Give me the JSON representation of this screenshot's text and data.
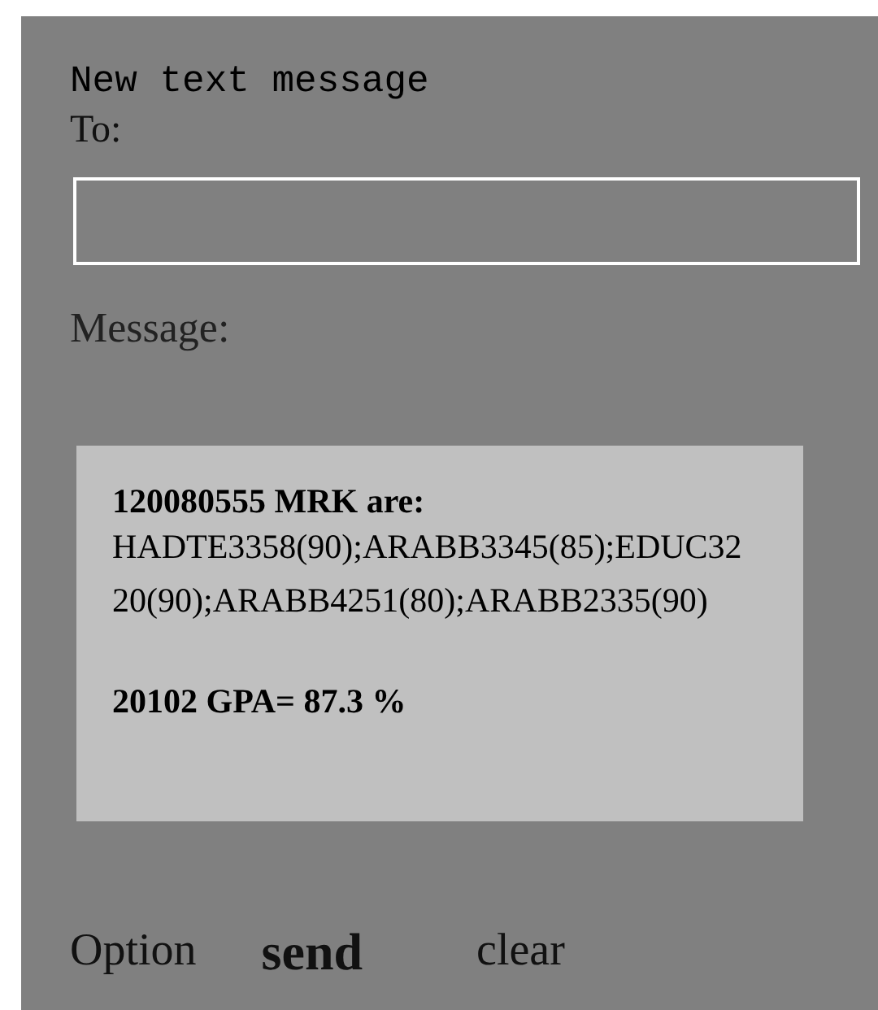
{
  "screen": {
    "title": "New text message"
  },
  "to_field": {
    "label": "To:"
  },
  "message": {
    "label": "Message:",
    "heading": "120080555 MRK are:",
    "body": "HADTE3358(90);ARABB3345(85);EDUC3220(90);ARABB4251(80);ARABB2335(90)",
    "footer": "20102 GPA= 87.3 %"
  },
  "softkeys": [
    {
      "label": "Option",
      "kind": "plain"
    },
    {
      "label": "send",
      "kind": "primary"
    },
    {
      "label": "clear",
      "kind": "plain"
    }
  ]
}
